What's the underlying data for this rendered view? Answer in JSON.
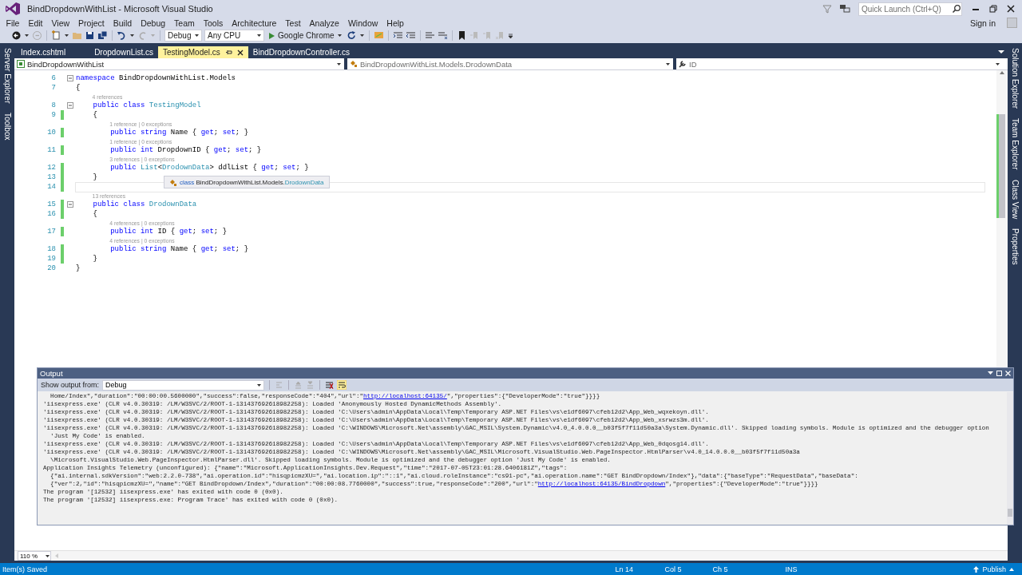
{
  "window": {
    "title": "BindDropdownWithList - Microsoft Visual Studio",
    "quick_launch": {
      "placeholder": "Quick Launch (Ctrl+Q)"
    }
  },
  "menu": [
    "File",
    "Edit",
    "View",
    "Project",
    "Build",
    "Debug",
    "Team",
    "Tools",
    "Architecture",
    "Test",
    "Analyze",
    "Window",
    "Help"
  ],
  "account": {
    "sign_in": "Sign in"
  },
  "toolbar": {
    "configuration": "Debug",
    "platform": "Any CPU",
    "run_target": "Google Chrome"
  },
  "left_dock": [
    "Server Explorer",
    "Toolbox"
  ],
  "right_dock": [
    "Solution Explorer",
    "Team Explorer",
    "Class View",
    "Properties"
  ],
  "document_tabs": [
    {
      "label": "Index.cshtml",
      "selected": false
    },
    {
      "label": "DropdownList.cs",
      "selected": false
    },
    {
      "label": "TestingModel.cs",
      "selected": true
    },
    {
      "label": "BindDropdownController.cs",
      "selected": false
    }
  ],
  "navigation_bar": {
    "project": "BindDropdownWithList",
    "type": "BindDropdownWithList.Models.DrodownData",
    "member": "ID"
  },
  "editor": {
    "lines": [
      {
        "number": "6",
        "fold": true,
        "changed": false,
        "current": false,
        "segments": [
          {
            "kind": "keyword",
            "text": "namespace"
          },
          {
            "kind": "text",
            "text": " BindDropdownWithList.Models"
          }
        ]
      },
      {
        "number": "7",
        "fold": false,
        "changed": false,
        "current": false,
        "segments": [
          {
            "kind": "text",
            "text": "{"
          }
        ]
      },
      {
        "number": "8",
        "fold": true,
        "changed": false,
        "current": false,
        "lens": "4 references",
        "segments": [
          {
            "kind": "keyword",
            "text": "    public class "
          },
          {
            "kind": "type",
            "text": "TestingModel"
          }
        ]
      },
      {
        "number": "9",
        "fold": false,
        "changed": true,
        "current": false,
        "segments": [
          {
            "kind": "text",
            "text": "    {"
          }
        ]
      },
      {
        "number": "10",
        "fold": false,
        "changed": true,
        "current": false,
        "lens": "1 reference | 0 exceptions",
        "segments": [
          {
            "kind": "keyword",
            "text": "        public string"
          },
          {
            "kind": "text",
            "text": " Name { "
          },
          {
            "kind": "keyword",
            "text": "get"
          },
          {
            "kind": "text",
            "text": "; "
          },
          {
            "kind": "keyword",
            "text": "set"
          },
          {
            "kind": "text",
            "text": "; }"
          }
        ]
      },
      {
        "number": "11",
        "fold": false,
        "changed": true,
        "current": false,
        "lens": "1 reference | 0 exceptions",
        "segments": [
          {
            "kind": "keyword",
            "text": "        public int"
          },
          {
            "kind": "text",
            "text": " DropdownID { "
          },
          {
            "kind": "keyword",
            "text": "get"
          },
          {
            "kind": "text",
            "text": "; "
          },
          {
            "kind": "keyword",
            "text": "set"
          },
          {
            "kind": "text",
            "text": "; }"
          }
        ]
      },
      {
        "number": "12",
        "fold": false,
        "changed": true,
        "current": false,
        "lens": "3 references | 0 exceptions",
        "segments": [
          {
            "kind": "keyword",
            "text": "        public "
          },
          {
            "kind": "type",
            "text": "List"
          },
          {
            "kind": "text",
            "text": "<"
          },
          {
            "kind": "type",
            "text": "DrodownData"
          },
          {
            "kind": "text",
            "text": "> ddlList { "
          },
          {
            "kind": "keyword",
            "text": "get"
          },
          {
            "kind": "text",
            "text": "; "
          },
          {
            "kind": "keyword",
            "text": "set"
          },
          {
            "kind": "text",
            "text": "; }"
          }
        ]
      },
      {
        "number": "13",
        "fold": false,
        "changed": true,
        "current": false,
        "segments": [
          {
            "kind": "text",
            "text": "    }"
          }
        ]
      },
      {
        "number": "14",
        "fold": false,
        "changed": true,
        "current": true
      },
      {
        "number": "15",
        "fold": true,
        "changed": true,
        "current": false,
        "lens": "13 references",
        "segments": [
          {
            "kind": "keyword",
            "text": "    public class "
          },
          {
            "kind": "type",
            "text": "DrodownData"
          }
        ]
      },
      {
        "number": "16",
        "fold": false,
        "changed": true,
        "current": false,
        "segments": [
          {
            "kind": "text",
            "text": "    {"
          }
        ]
      },
      {
        "number": "17",
        "fold": false,
        "changed": true,
        "current": false,
        "lens": "4 references | 0 exceptions",
        "segments": [
          {
            "kind": "keyword",
            "text": "        public int"
          },
          {
            "kind": "text",
            "text": " ID { "
          },
          {
            "kind": "keyword",
            "text": "get"
          },
          {
            "kind": "text",
            "text": "; "
          },
          {
            "kind": "keyword",
            "text": "set"
          },
          {
            "kind": "text",
            "text": "; }"
          }
        ]
      },
      {
        "number": "18",
        "fold": false,
        "changed": true,
        "current": false,
        "lens": "4 references | 0 exceptions",
        "segments": [
          {
            "kind": "keyword",
            "text": "        public string"
          },
          {
            "kind": "text",
            "text": " Name { "
          },
          {
            "kind": "keyword",
            "text": "get"
          },
          {
            "kind": "text",
            "text": "; "
          },
          {
            "kind": "keyword",
            "text": "set"
          },
          {
            "kind": "text",
            "text": "; }"
          }
        ]
      },
      {
        "number": "19",
        "fold": false,
        "changed": true,
        "current": false,
        "segments": [
          {
            "kind": "text",
            "text": "    }"
          }
        ]
      },
      {
        "number": "20",
        "fold": false,
        "changed": false,
        "current": false,
        "segments": [
          {
            "kind": "text",
            "text": "}"
          }
        ]
      }
    ],
    "tooltip": {
      "segments": [
        {
          "kind": "keyword",
          "text": "class"
        },
        {
          "kind": "text",
          "text": " BindDropdownWithList.Models."
        },
        {
          "kind": "type",
          "text": "DrodownData"
        }
      ]
    },
    "zoom": "110 %"
  },
  "output": {
    "title": "Output",
    "source_label": "Show output from:",
    "source": "Debug",
    "lines": [
      {
        "segments": [
          {
            "kind": "text",
            "text": "  Home/Index\",\"duration\":\"00:00:00.5600000\",\"success\":false,\"responseCode\":\"404\",\"url\":\""
          },
          {
            "kind": "link",
            "text": "http://localhost:64135/"
          },
          {
            "kind": "text",
            "text": "\",\"properties\":{\"DeveloperMode\":\"true\"}}}}"
          }
        ]
      },
      {
        "segments": [
          {
            "kind": "text",
            "text": "'iisexpress.exe' (CLR v4.0.30319: /LM/W3SVC/2/ROOT-1-131437692618982258): Loaded 'Anonymously Hosted DynamicMethods Assembly'."
          }
        ]
      },
      {
        "segments": [
          {
            "kind": "text",
            "text": "'iisexpress.exe' (CLR v4.0.30319: /LM/W3SVC/2/ROOT-1-131437692618982258): Loaded 'C:\\Users\\admin\\AppData\\Local\\Temp\\Temporary ASP.NET Files\\vs\\e1df6097\\cfeb12d2\\App_Web_wqxekoyn.dll'."
          }
        ]
      },
      {
        "segments": [
          {
            "kind": "text",
            "text": "'iisexpress.exe' (CLR v4.0.30319: /LM/W3SVC/2/ROOT-1-131437692618982258): Loaded 'C:\\Users\\admin\\AppData\\Local\\Temp\\Temporary ASP.NET Files\\vs\\e1df6097\\cfeb12d2\\App_Web_xsrwzs3m.dll'."
          }
        ]
      },
      {
        "segments": [
          {
            "kind": "text",
            "text": "'iisexpress.exe' (CLR v4.0.30319: /LM/W3SVC/2/ROOT-1-131437692618982258): Loaded 'C:\\WINDOWS\\Microsoft.Net\\assembly\\GAC_MSIL\\System.Dynamic\\v4.0_4.0.0.0__b03f5f7f11d50a3a\\System.Dynamic.dll'. Skipped loading symbols. Module is optimized and the debugger option"
          }
        ]
      },
      {
        "segments": [
          {
            "kind": "text",
            "text": "  'Just My Code' is enabled."
          }
        ]
      },
      {
        "segments": [
          {
            "kind": "text",
            "text": "'iisexpress.exe' (CLR v4.0.30319: /LM/W3SVC/2/ROOT-1-131437692618982258): Loaded 'C:\\Users\\admin\\AppData\\Local\\Temp\\Temporary ASP.NET Files\\vs\\e1df6097\\cfeb12d2\\App_Web_0dqosg14.dll'."
          }
        ]
      },
      {
        "segments": [
          {
            "kind": "text",
            "text": "'iisexpress.exe' (CLR v4.0.30319: /LM/W3SVC/2/ROOT-1-131437692618982258): Loaded 'C:\\WINDOWS\\Microsoft.Net\\assembly\\GAC_MSIL\\Microsoft.VisualStudio.Web.PageInspector.HtmlParser\\v4.0_14.0.0.0__b03f5f7f11d50a3a"
          }
        ]
      },
      {
        "segments": [
          {
            "kind": "text",
            "text": "  \\Microsoft.VisualStudio.Web.PageInspector.HtmlParser.dll'. Skipped loading symbols. Module is optimized and the debugger option 'Just My Code' is enabled."
          }
        ]
      },
      {
        "segments": [
          {
            "kind": "text",
            "text": "Application Insights Telemetry (unconfigured): {\"name\":\"Microsoft.ApplicationInsights.Dev.Request\",\"time\":\"2017-07-05T23:01:28.6406181Z\",\"tags\":"
          }
        ]
      },
      {
        "segments": [
          {
            "kind": "text",
            "text": "  {\"ai.internal.sdkVersion\":\"web:2.2.0-738\",\"ai.operation.id\":\"hisqpicmzXU=\",\"ai.location.ip\":\"::1\",\"ai.cloud.roleInstance\":\"cs91-pc\",\"ai.operation.name\":\"GET BindDropdown/Index\"},\"data\":{\"baseType\":\"RequestData\",\"baseData\":"
          }
        ]
      },
      {
        "segments": [
          {
            "kind": "text",
            "text": "  {\"ver\":2,\"id\":\"hisqpicmzXU=\",\"name\":\"GET BindDropdown/Index\",\"duration\":\"00:00:08.7760000\",\"success\":true,\"responseCode\":\"200\",\"url\":\""
          },
          {
            "kind": "link",
            "text": "http://localhost:64135/BindDropdown"
          },
          {
            "kind": "text",
            "text": "\",\"properties\":{\"DeveloperMode\":\"true\"}}}}"
          }
        ]
      },
      {
        "segments": [
          {
            "kind": "text",
            "text": "The program '[12532] iisexpress.exe' has exited with code 0 (0x0)."
          }
        ]
      },
      {
        "segments": [
          {
            "kind": "text",
            "text": "The program '[12532] iisexpress.exe: Program Trace' has exited with code 0 (0x0)."
          }
        ]
      }
    ]
  },
  "status_bar": {
    "message": "Item(s) Saved",
    "line": "Ln 14",
    "column": "Col 5",
    "char": "Ch 5",
    "mode": "INS",
    "publish": "Publish"
  }
}
